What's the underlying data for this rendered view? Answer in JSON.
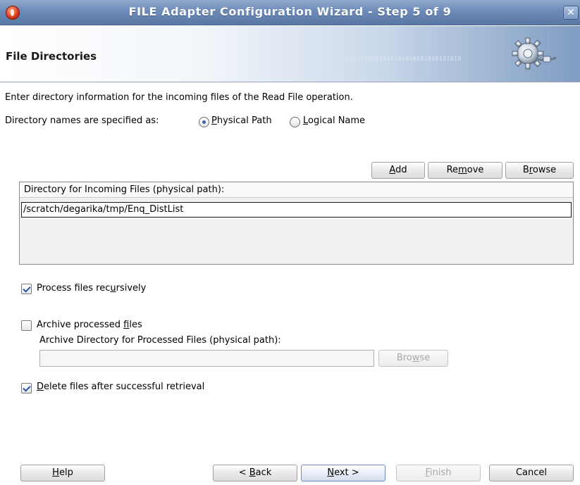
{
  "window": {
    "title": "FILE Adapter Configuration Wizard - Step 5 of 9",
    "close_glyph": "✕"
  },
  "header": {
    "title": "File Directories",
    "binary_text": "0101010101010101010101010101010"
  },
  "main": {
    "description": "Enter directory information for the incoming files of the Read File operation.",
    "dir_names_label": "Directory names are specified as:",
    "radio_physical": {
      "before": "",
      "accel": "P",
      "after": "hysical Path",
      "checked": true
    },
    "radio_logical": {
      "before": "",
      "accel": "L",
      "after": "ogical Name",
      "checked": false
    },
    "buttons": {
      "add": {
        "before": "",
        "accel": "A",
        "after": "dd"
      },
      "remove": {
        "before": "Re",
        "accel": "m",
        "after": "ove"
      },
      "browse": {
        "before": "B",
        "accel": "r",
        "after": "owse"
      }
    },
    "table": {
      "header": "Directory for Incoming Files (physical path):",
      "rows": [
        "/scratch/degarika/tmp/Enq_DistList"
      ]
    },
    "process_recursively": {
      "before": "Process files rec",
      "accel": "u",
      "after": "rsively",
      "checked": true
    },
    "archive_files": {
      "before": "Archive processed ",
      "accel": "f",
      "after": "iles",
      "checked": false
    },
    "archive_dir_label": "Archive Directory for Processed Files (physical path):",
    "archive_dir_value": "",
    "archive_browse": {
      "before": "Bro",
      "accel": "w",
      "after": "se",
      "enabled": false
    },
    "delete_files": {
      "before": "",
      "accel": "D",
      "after": "elete files after successful retrieval",
      "checked": true
    }
  },
  "footer": {
    "help": {
      "before": "",
      "accel": "H",
      "after": "elp"
    },
    "back": {
      "before": "< ",
      "accel": "B",
      "after": "ack"
    },
    "next": {
      "before": "",
      "accel": "N",
      "after": "ext >"
    },
    "finish": {
      "before": "",
      "accel": "F",
      "after": "inish",
      "enabled": false
    },
    "cancel": {
      "label": "Cancel"
    }
  },
  "colors": {
    "title_bar": "#6d8ab8",
    "accent": "#3b64a8",
    "disabled_text": "#a8a8a8"
  }
}
